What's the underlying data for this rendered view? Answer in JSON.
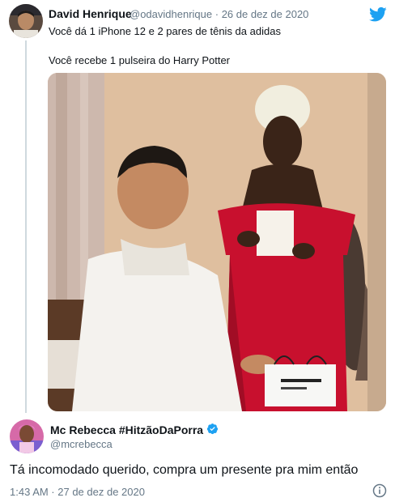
{
  "quoted_tweet": {
    "author_name": "David Henrique",
    "author_handle": "@odavidhenrique",
    "separator": "·",
    "date": "26 de dez de 2020",
    "line1": "Você dá 1 iPhone 12 e 2 pares de tênis da adidas",
    "line2": "Você recebe 1 pulseira do Harry Potter",
    "media_icon": "photo",
    "brand_icon": "twitter-bird-icon",
    "brand_color": "#1da1f2"
  },
  "reply_tweet": {
    "author_name": "Mc Rebecca #HitzãoDaPorra",
    "author_handle": "@mcrebecca",
    "verified_icon": "verified-badge-icon",
    "text": "Tá incomodado querido, compra um presente pra mim então",
    "timestamp": "1:43 AM · 27 de dez de 2020",
    "info_icon": "info-icon"
  },
  "colors": {
    "text": "#0f1419",
    "secondary_text": "#657786",
    "accent": "#1da1f2",
    "thread_line": "#cfd9de"
  }
}
